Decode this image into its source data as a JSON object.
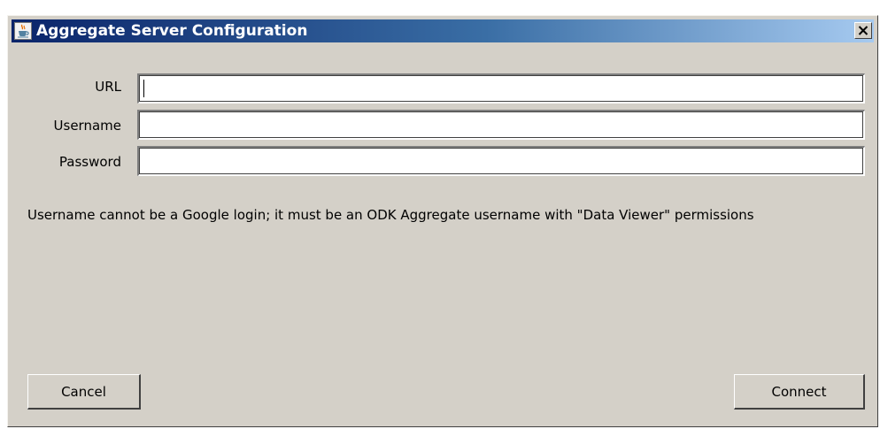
{
  "window": {
    "title": "Aggregate Server Configuration",
    "app_icon": "java-coffee-cup-icon",
    "close_icon": "close-x-icon",
    "titlebar_color_start": "#0a246a",
    "titlebar_color_end": "#a6caf0",
    "background_color": "#d4d0c8"
  },
  "form": {
    "url_label": "URL",
    "url_value": "",
    "username_label": "Username",
    "username_value": "",
    "password_label": "Password",
    "password_value": ""
  },
  "note": "Username cannot be a Google login; it must be an ODK Aggregate username with \"Data Viewer\" permissions",
  "buttons": {
    "cancel_label": "Cancel",
    "connect_label": "Connect"
  }
}
